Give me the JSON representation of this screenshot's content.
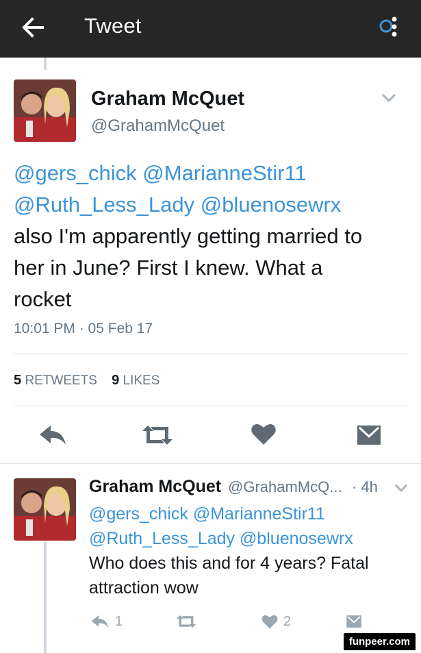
{
  "header": {
    "back_icon": "arrow-left-icon",
    "title": "Tweet",
    "menu_icon": "overflow-menu-icon"
  },
  "tweet": {
    "author_name": "Graham McQuet",
    "author_handle": "@GrahamMcQuet",
    "mentions_line1": [
      "@gers_chick",
      "@MarianneStir11"
    ],
    "mentions_line2": [
      "@Ruth_Less_Lady",
      "@bluenosewrx"
    ],
    "text_lines": [
      "also I'm apparently getting married to",
      "her in June? First I knew. What a",
      "rocket"
    ],
    "timestamp": "10:01 PM · 05 Feb 17",
    "retweets_count": "5",
    "retweets_label": "RETWEETS",
    "likes_count": "9",
    "likes_label": "LIKES"
  },
  "reply": {
    "author_name": "Graham McQuet",
    "author_handle": "@GrahamMcQ...",
    "age": "· 4h",
    "mentions_line1": [
      "@gers_chick",
      "@MarianneStir11"
    ],
    "mentions_line2": [
      "@Ruth_Less_Lady",
      "@bluenosewrx"
    ],
    "text_lines": [
      "Who does this and for 4 years? Fatal",
      "attraction wow"
    ],
    "reply_count": "1",
    "like_count": "2"
  },
  "watermark": "funpeer.com",
  "colors": {
    "appbar": "#262626",
    "link": "#3b94d9",
    "secondary": "#657786",
    "icon": "#5f6a74"
  }
}
